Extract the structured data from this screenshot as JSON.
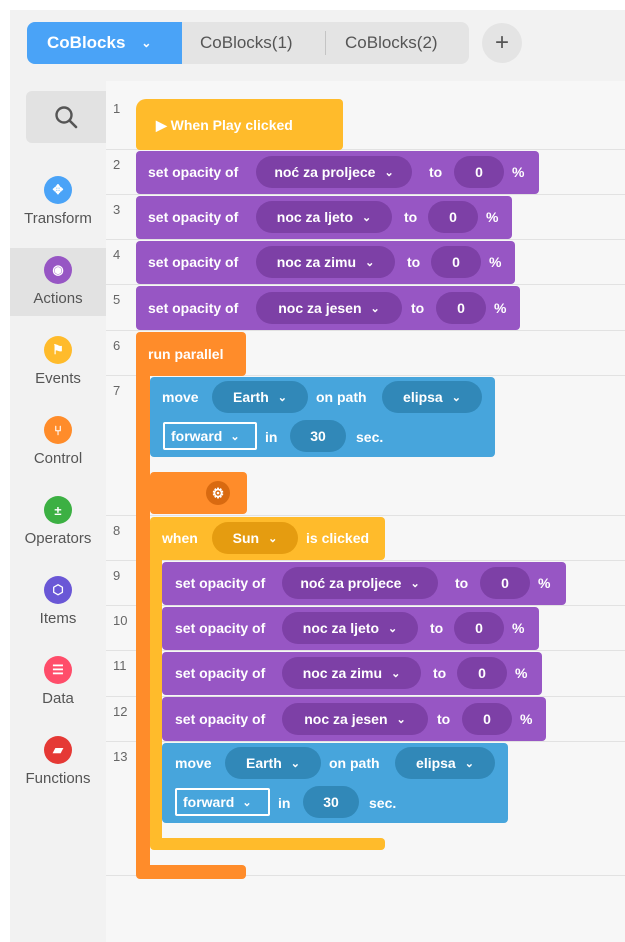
{
  "tabs": [
    {
      "label": "CoBlocks",
      "active": true
    },
    {
      "label": "CoBlocks(1)"
    },
    {
      "label": "CoBlocks(2)"
    }
  ],
  "add_tab": "+",
  "categories": [
    {
      "label": "Transform",
      "icon": "move-icon",
      "color": "#4aa3f7"
    },
    {
      "label": "Actions",
      "icon": "eye-icon",
      "color": "#9756c4"
    },
    {
      "label": "Events",
      "icon": "flag-icon",
      "color": "#ffbb2b"
    },
    {
      "label": "Control",
      "icon": "fork-icon",
      "color": "#ff8c2a"
    },
    {
      "label": "Operators",
      "icon": "plus-minus-icon",
      "color": "#3cb043"
    },
    {
      "label": "Items",
      "icon": "cube-icon",
      "color": "#6a57d6"
    },
    {
      "label": "Data",
      "icon": "database-icon",
      "color": "#ff4d6a"
    },
    {
      "label": "Functions",
      "icon": "function-icon",
      "color": "#e53935"
    }
  ],
  "line_numbers": [
    "1",
    "2",
    "3",
    "4",
    "5",
    "6",
    "7",
    "8",
    "9",
    "10",
    "11",
    "12",
    "13"
  ],
  "blocks": {
    "play": "▶ When Play clicked",
    "opacity": [
      {
        "label": "set opacity of",
        "object": "noć za proljece",
        "to": "to",
        "value": "0",
        "unit": "%"
      },
      {
        "label": "set opacity of",
        "object": "noc za ljeto",
        "to": "to",
        "value": "0",
        "unit": "%"
      },
      {
        "label": "set opacity of",
        "object": "noc za zimu",
        "to": "to",
        "value": "0",
        "unit": "%"
      },
      {
        "label": "set opacity of",
        "object": "noc za jesen",
        "to": "to",
        "value": "0",
        "unit": "%"
      }
    ],
    "parallel": "run parallel",
    "move1": {
      "label": "move",
      "object": "Earth",
      "path_label": "on path",
      "path": "elipsa",
      "direction": "forward",
      "in": "in",
      "duration": "30",
      "unit": "sec."
    },
    "when": {
      "label": "when",
      "object": "Sun",
      "event": "is clicked"
    },
    "opacity2": [
      {
        "label": "set opacity of",
        "object": "noć za proljece",
        "to": "to",
        "value": "0",
        "unit": "%"
      },
      {
        "label": "set opacity of",
        "object": "noc za ljeto",
        "to": "to",
        "value": "0",
        "unit": "%"
      },
      {
        "label": "set opacity of",
        "object": "noc za zimu",
        "to": "to",
        "value": "0",
        "unit": "%"
      },
      {
        "label": "set opacity of",
        "object": "noc za jesen",
        "to": "to",
        "value": "0",
        "unit": "%"
      }
    ],
    "move2": {
      "label": "move",
      "object": "Earth",
      "path_label": "on path",
      "path": "elipsa",
      "direction": "forward",
      "in": "in",
      "duration": "30",
      "unit": "sec."
    }
  }
}
